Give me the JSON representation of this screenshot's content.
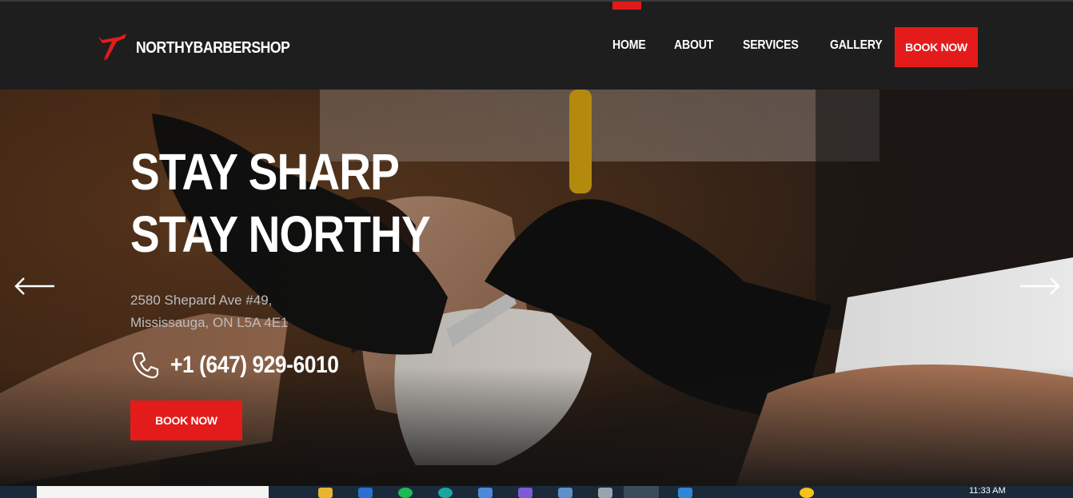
{
  "brand": {
    "name": "NORTHYBARBERSHOP",
    "accent": "#e41b1b",
    "icon": "razor-logo-icon"
  },
  "nav": {
    "items": [
      {
        "label": "HOME",
        "active": true
      },
      {
        "label": "ABOUT"
      },
      {
        "label": "SERVICES"
      },
      {
        "label": "GALLERY"
      }
    ],
    "book_label": "BOOK NOW"
  },
  "hero": {
    "title": "STAY SHARP STAY NORTHY",
    "address_line1": "2580 Shepard Ave #49,",
    "address_line2": "Mississauga, ON L5A 4E1",
    "phone": "+1 (647) 929-6010",
    "phone_icon": "phone-icon",
    "book_label": "BOOK NOW",
    "prev_icon": "arrow-left-icon",
    "next_icon": "arrow-right-icon"
  },
  "taskbar": {
    "clock": "11:33 AM"
  }
}
